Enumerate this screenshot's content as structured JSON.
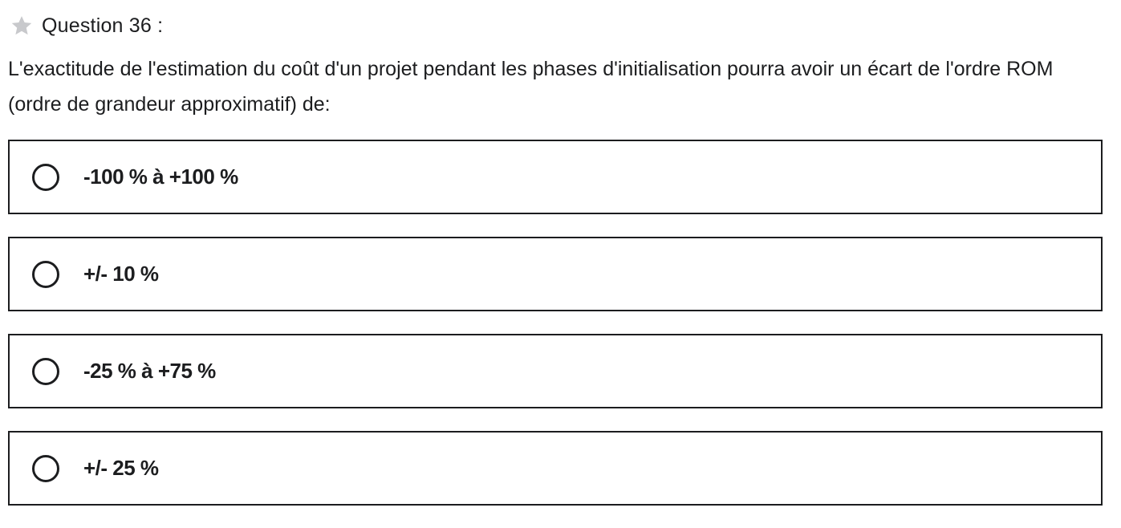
{
  "question": {
    "number_label": "Question 36 :",
    "text": "L'exactitude de l'estimation du coût d'un projet pendant les phases d'initialisation pourra avoir un écart de l'ordre ROM (ordre de grandeur approximatif) de:",
    "star_icon": "star-icon",
    "star_color": "#c8c9cc"
  },
  "options": [
    {
      "label": "-100 % à +100 %"
    },
    {
      "label": "+/- 10 %"
    },
    {
      "label": "-25 % à +75 %"
    },
    {
      "label": "+/- 25 %"
    }
  ],
  "colors": {
    "text": "#1c1d1f",
    "border": "#1c1d1f",
    "background": "#ffffff"
  }
}
